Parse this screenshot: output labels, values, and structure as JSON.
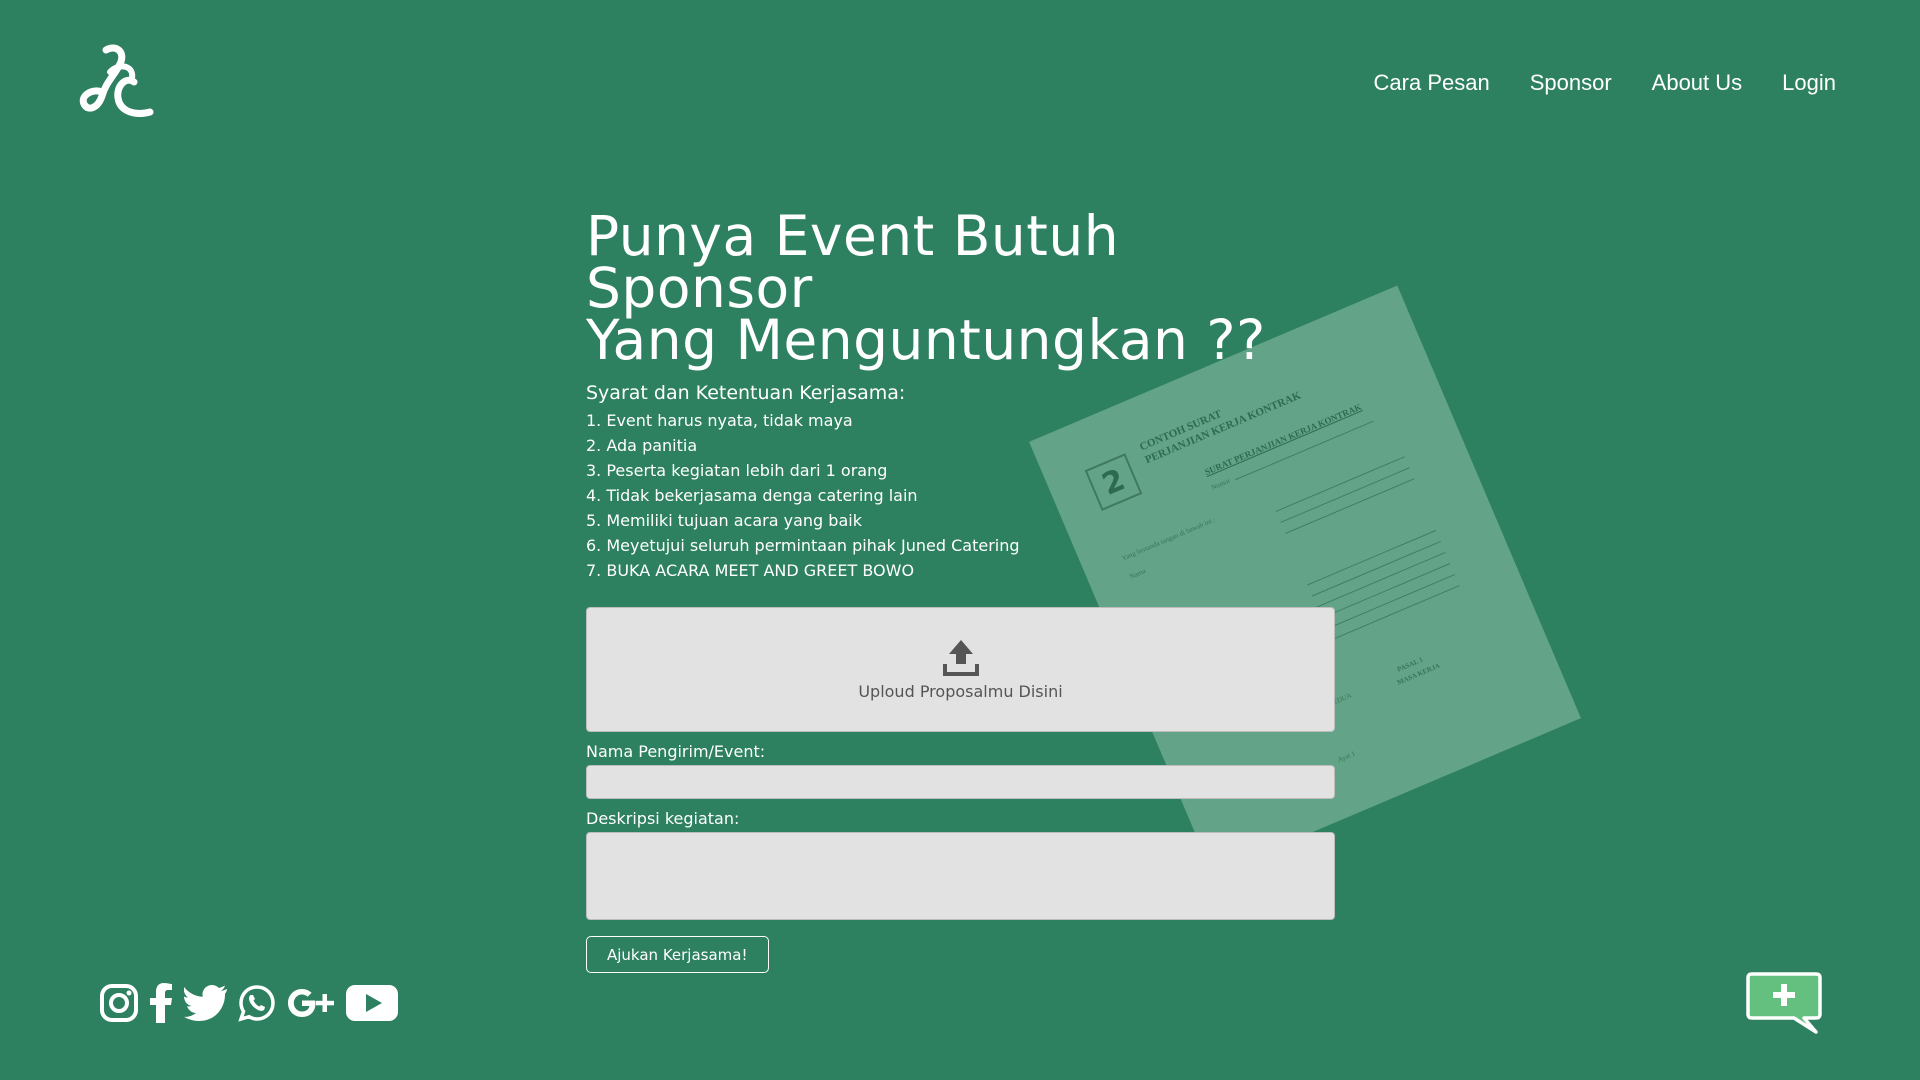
{
  "header": {
    "logo_icon": "jc-script-logo",
    "nav": [
      {
        "label": "Cara Pesan"
      },
      {
        "label": "Sponsor"
      },
      {
        "label": "About Us"
      },
      {
        "label": "Login"
      }
    ]
  },
  "illustration": {
    "number": "2",
    "title_line1": "CONTOH SURAT",
    "title_line2": "PERJANJIAN KERJA KONTRAK",
    "subtitle": "SURAT PERJANJIAN KERJA KONTRAK",
    "text_nomor": "Nomor",
    "text_intro": "Yang bertanda tangan di bawah ini :",
    "text_nama": "Nama",
    "text_pasal": "PASAL 1",
    "text_masa": "MASA KERJA",
    "text_pihak": "PIHAK KEDUA",
    "text_ayat": "Ayat 1"
  },
  "main": {
    "headline_line1": "Punya Event Butuh Sponsor",
    "headline_line2": "Yang Menguntungkan ??",
    "terms_title": "Syarat dan Ketentuan Kerjasama:",
    "terms": [
      "1. Event harus nyata, tidak maya",
      "2. Ada panitia",
      "3. Peserta kegiatan lebih dari 1 orang",
      "4. Tidak bekerjasama denga catering lain",
      "5. Memiliki tujuan acara yang baik",
      "6. Meyetujui seluruh permintaan pihak Juned Catering",
      "7. BUKA ACARA MEET AND GREET BOWO"
    ],
    "upload_label": "Uploud Proposalmu Disini",
    "upload_icon": "upload-icon",
    "name_label": "Nama Pengirim/Event:",
    "name_value": "",
    "desc_label": "Deskripsi kegiatan:",
    "desc_value": "",
    "submit_label": "Ajukan Kerjasama!"
  },
  "social": [
    {
      "icon": "instagram-icon"
    },
    {
      "icon": "facebook-icon"
    },
    {
      "icon": "twitter-icon"
    },
    {
      "icon": "whatsapp-icon"
    },
    {
      "icon": "google-plus-icon"
    },
    {
      "icon": "youtube-icon"
    }
  ],
  "chat_button_icon": "add-chat-icon",
  "colors": {
    "background": "#2d8160",
    "document": "#63a387",
    "field": "#e2e2e2",
    "chat_fill": "#63c07f"
  }
}
